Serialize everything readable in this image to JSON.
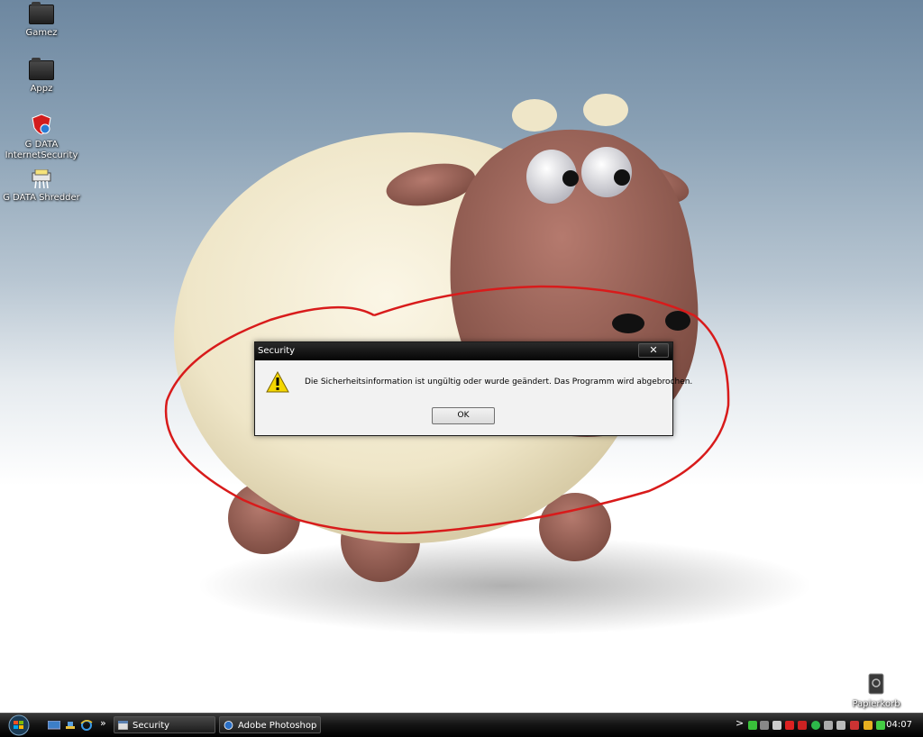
{
  "desktop": {
    "icons": [
      {
        "label": "Gamez"
      },
      {
        "label": "Appz"
      },
      {
        "label": "G DATA InternetSecurity"
      },
      {
        "label": "G DATA Shredder"
      },
      {
        "label": "Papierkorb"
      }
    ]
  },
  "dialog": {
    "title": "Security",
    "close_label": "✕",
    "message": "Die Sicherheitsinformation ist ungültig oder wurde geändert. Das Programm wird abgebrochen.",
    "ok_label": "OK"
  },
  "taskbar": {
    "quicklaunch_more": "»",
    "buttons": [
      {
        "label": "Security"
      },
      {
        "label": "Adobe Photoshop"
      }
    ],
    "tray_expand": ">",
    "clock": "04:07"
  },
  "colors": {
    "annotation_red": "#d81b1b",
    "dialog_title_bg": "#050505",
    "warning_yellow": "#f5d700"
  }
}
